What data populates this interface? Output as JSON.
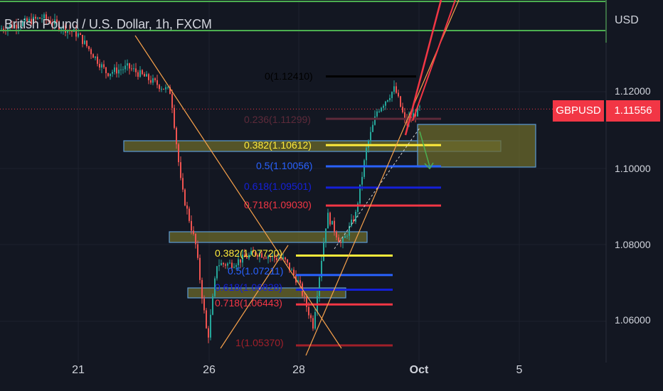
{
  "header": {
    "symbol_title": "British Pound / U.S. Dollar, 1h, FXCM",
    "currency": "USD"
  },
  "price_axis": {
    "ticks": [
      {
        "label": "1.12000",
        "value": 1.12
      },
      {
        "label": "1.10000",
        "value": 1.1
      },
      {
        "label": "1.08000",
        "value": 1.08
      },
      {
        "label": "1.06000",
        "value": 1.06
      }
    ]
  },
  "time_axis": {
    "ticks": [
      {
        "label": "21",
        "bold": false
      },
      {
        "label": "26",
        "bold": false
      },
      {
        "label": "28",
        "bold": false
      },
      {
        "label": "Oct",
        "bold": true
      },
      {
        "label": "5",
        "bold": false
      }
    ]
  },
  "current_price": {
    "ticker": "GBPUSD",
    "price": "1.11556",
    "value": 1.11556,
    "color": "#f23645"
  },
  "fib_upper": [
    {
      "label": "0(1.12410)",
      "value": 1.1241,
      "color": "#000000"
    },
    {
      "label": "0.236(1.11299)",
      "value": 1.11299,
      "color": "#5d2a3a"
    },
    {
      "label": "0.382(1.10612)",
      "value": 1.10612,
      "color": "#ffeb3b"
    },
    {
      "label": "0.5(1.10056)",
      "value": 1.10056,
      "color": "#2962ff"
    },
    {
      "label": "0.618(1.09501)",
      "value": 1.09501,
      "color": "#1520d8"
    },
    {
      "label": "0.718(1.09030)",
      "value": 1.0903,
      "color": "#f23645"
    }
  ],
  "fib_lower": [
    {
      "label": "0.382(1.07720)",
      "value": 1.0772,
      "color": "#ffeb3b"
    },
    {
      "label": "0.5(1.07211)",
      "value": 1.07211,
      "color": "#2962ff"
    },
    {
      "label": "0.618(1.06828)",
      "value": 1.06828,
      "color": "#1520d8"
    },
    {
      "label": "0.718(1.06443)",
      "value": 1.06443,
      "color": "#f23645"
    },
    {
      "label": "1(1.05370)",
      "value": 1.0537,
      "color": "#a0202a"
    }
  ],
  "colors": {
    "background": "#131722",
    "bull_candle": "#26a69a",
    "bear_candle": "#ef5350",
    "green_lines": "#4caf50",
    "trendline": "#f7a14b",
    "red_trendline": "#f23645",
    "zone_fill": "#6b6a2b",
    "zone_border": "#5b9bd5"
  }
}
